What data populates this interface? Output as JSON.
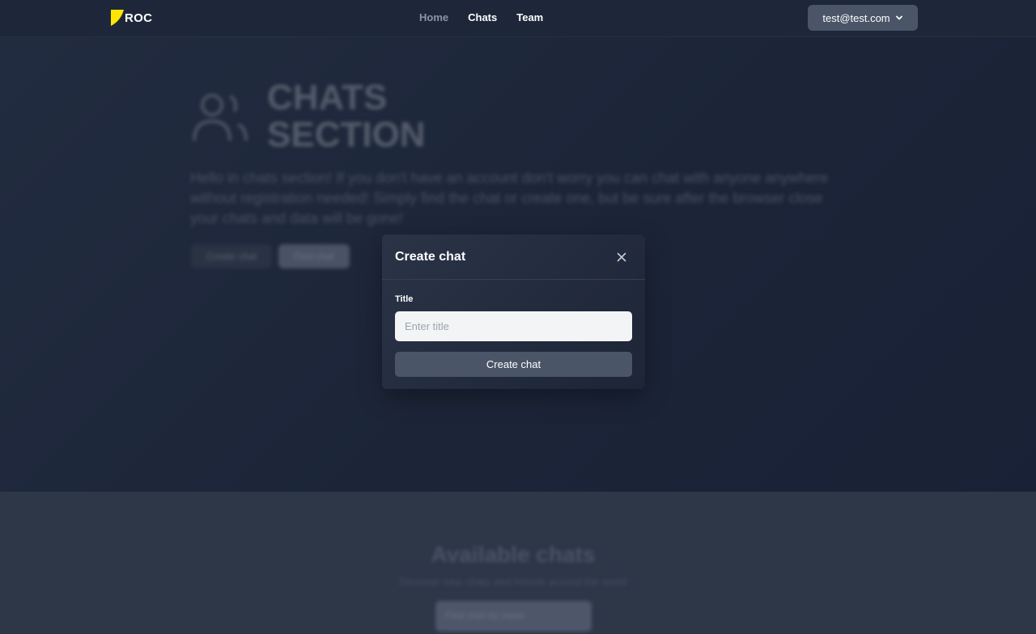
{
  "navbar": {
    "logo_text": "ROC",
    "brand_color": "#FFE600",
    "links": [
      {
        "label": "Home",
        "active": false
      },
      {
        "label": "Chats",
        "active": true
      },
      {
        "label": "Team",
        "active": true
      }
    ],
    "user_email": "test@test.com",
    "user_menu_icon": "chevron-down-icon"
  },
  "hero": {
    "icon": "users-icon",
    "title": "CHATS\nSECTION",
    "description": "Hello in chats section! If you don't have an account don't worry you can chat with anyone anywhere without registration needed! Simply find the chat or create one, but be sure after the browser close your chats and data will be gone!",
    "create_button": "Create chat",
    "find_button": "Find chat"
  },
  "available": {
    "title": "Available chats",
    "subtitle": "Discover new chats and friends around the world",
    "search_placeholder": "Find chat by name"
  },
  "modal": {
    "title": "Create chat",
    "close_icon": "close-icon",
    "field_label": "Title",
    "input_value": "",
    "input_placeholder": "Enter title",
    "submit_label": "Create chat"
  }
}
